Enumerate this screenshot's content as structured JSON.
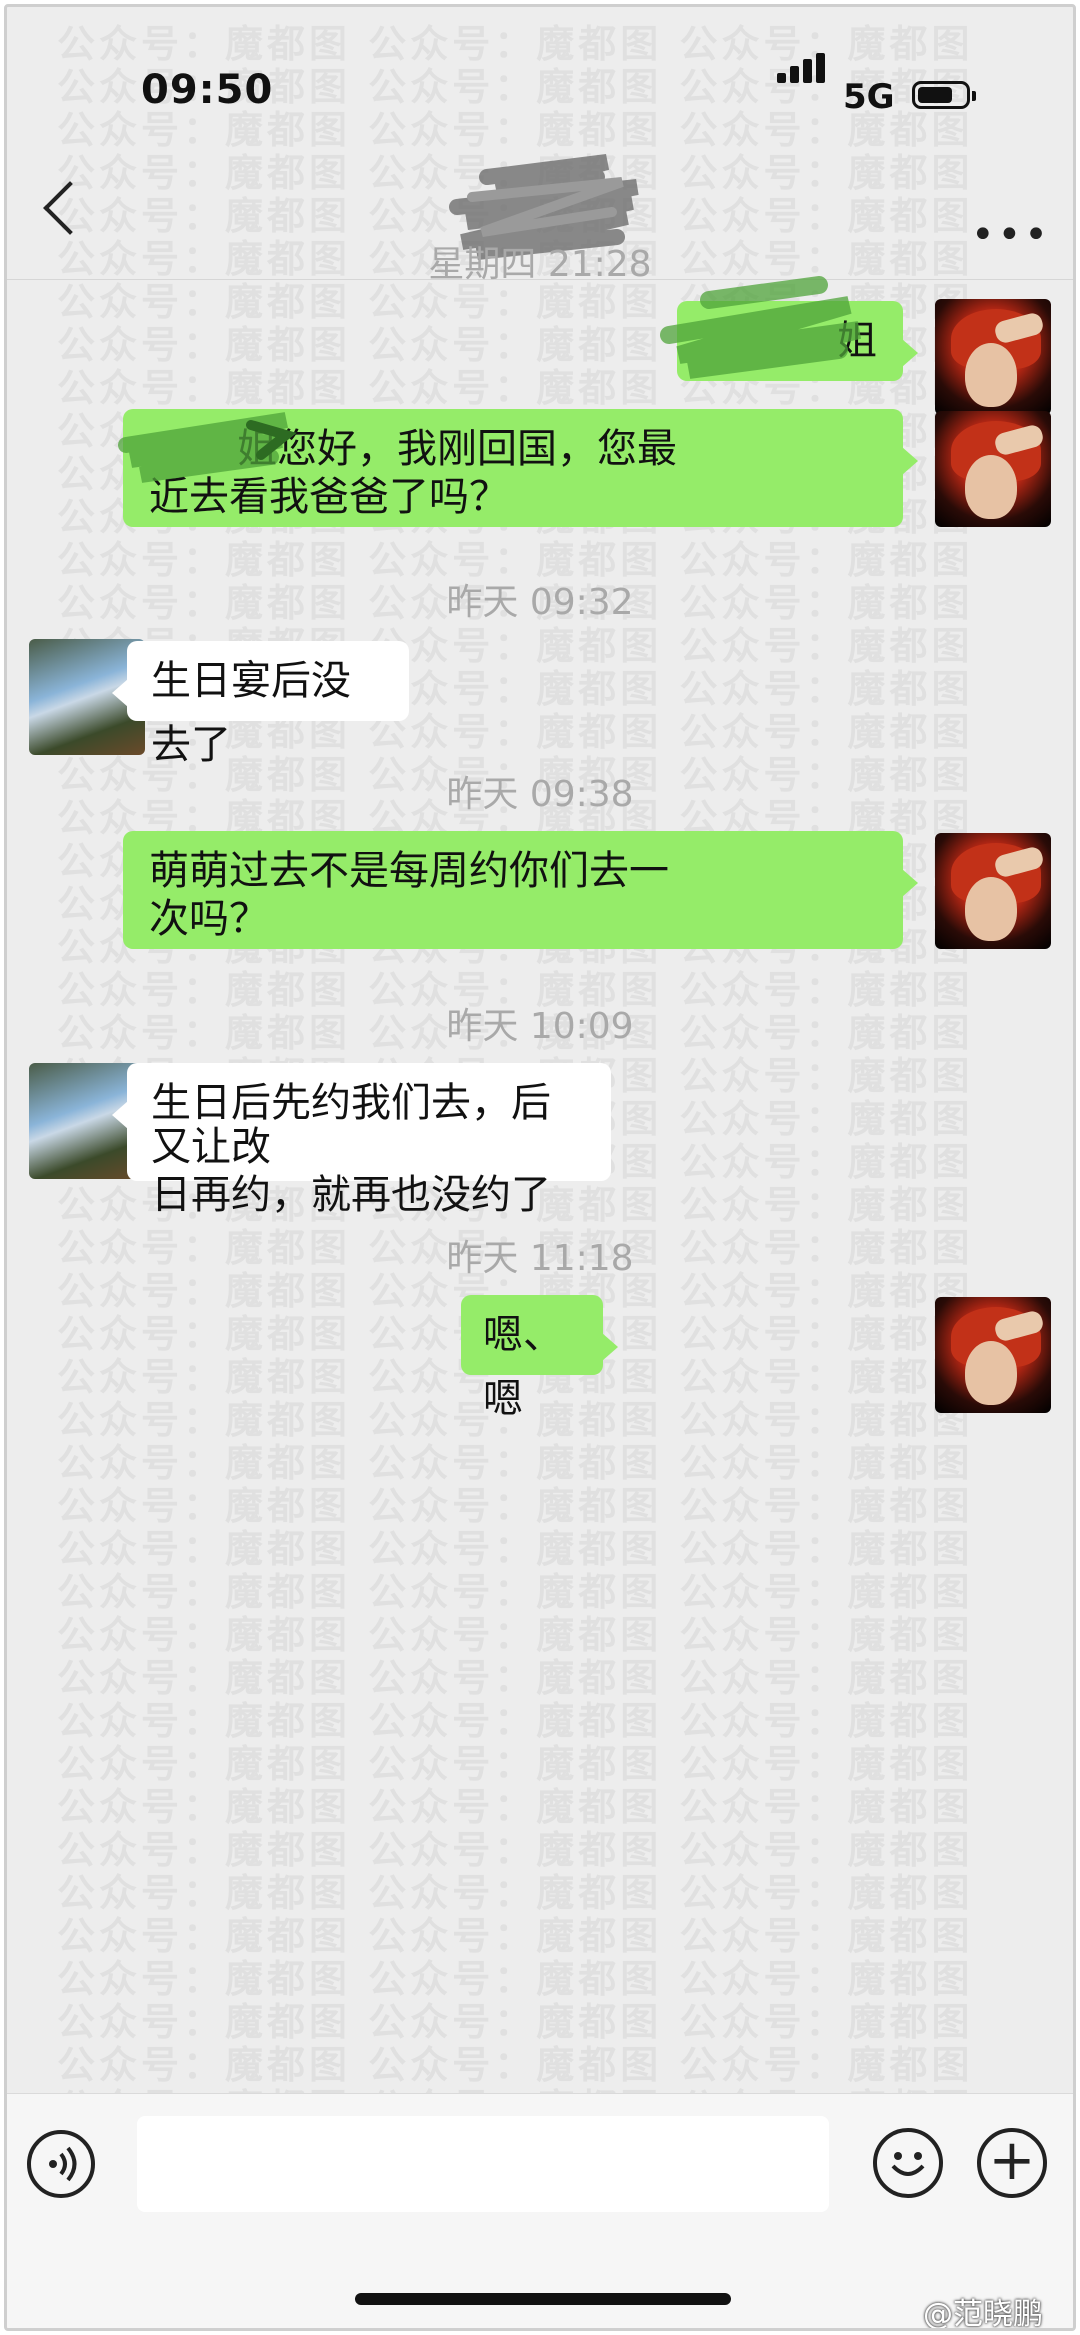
{
  "status_bar": {
    "time": "09:50",
    "network": "5G"
  },
  "header": {
    "title": ""
  },
  "watermark": {
    "text": "公众号：魔都图"
  },
  "messages": [
    {
      "type": "time",
      "text": "星期四 21:28"
    },
    {
      "type": "sent",
      "lines": [
        "姐"
      ]
    },
    {
      "type": "sent",
      "lines": [
        "姐您好，我刚回国，您最",
        "近去看我爸爸了吗？"
      ]
    },
    {
      "type": "time",
      "text": "昨天 09:32"
    },
    {
      "type": "received",
      "lines": [
        "生日宴后没去了"
      ]
    },
    {
      "type": "time",
      "text": "昨天 09:38"
    },
    {
      "type": "sent",
      "lines": [
        "萌萌过去不是每周约你们去一",
        "次吗？"
      ]
    },
    {
      "type": "time",
      "text": "昨天 10:09"
    },
    {
      "type": "received",
      "lines": [
        "生日后先约我们去，后又让改",
        "日再约，就再也没约了"
      ]
    },
    {
      "type": "time",
      "text": "昨天 11:18"
    },
    {
      "type": "sent",
      "lines": [
        "嗯、嗯"
      ]
    }
  ],
  "input_bar": {
    "placeholder": ""
  },
  "source_watermark": "@范晓鹏",
  "colors": {
    "sent_bubble": "#95ec69",
    "received_bubble": "#ffffff",
    "background": "#ededed",
    "time_label": "#a9a9a9"
  },
  "icons": [
    "back-icon",
    "more-icon",
    "voice-icon",
    "emoji-icon",
    "plus-icon",
    "signal-icon",
    "battery-icon"
  ]
}
